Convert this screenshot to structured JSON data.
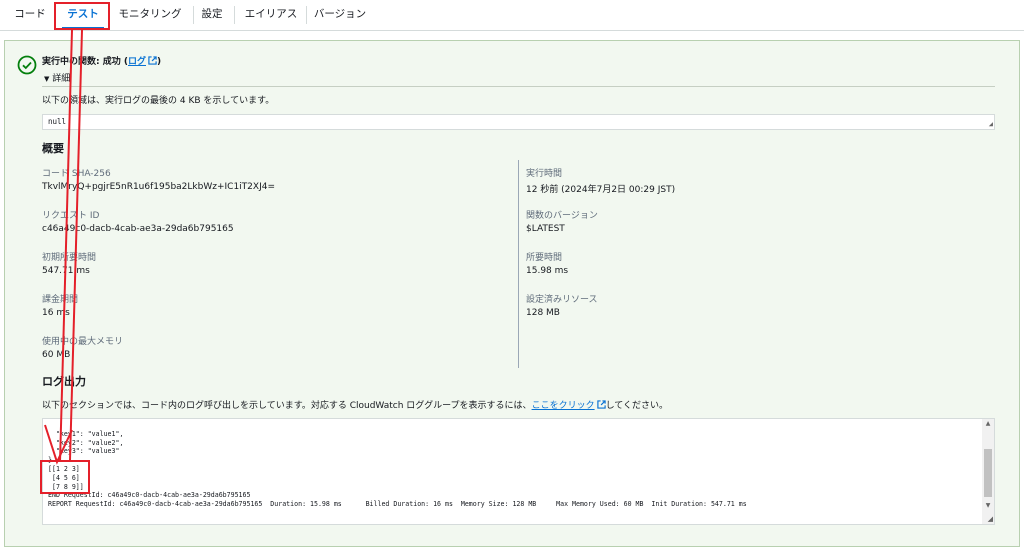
{
  "tabs": [
    {
      "label": "コード"
    },
    {
      "label": "テスト",
      "active": true
    },
    {
      "label": "モニタリング"
    },
    {
      "label": "設定"
    },
    {
      "label": "エイリアス"
    },
    {
      "label": "バージョン"
    }
  ],
  "result": {
    "status_prefix": "実行中の関数: 成功 (",
    "log_link": "ログ",
    "status_suffix": ")",
    "detail_label": "詳細",
    "description": "以下の領域は、実行ログの最後の 4 KB を示しています。",
    "output_value": "null"
  },
  "summary": {
    "title": "概要",
    "left": [
      {
        "label": "コード SHA-256",
        "value": "TkvlMryQ+pgjrE5nR1u6f195ba2LkbWz+IC1iT2XJ4="
      },
      {
        "label": "リクエスト ID",
        "value": "c46a49c0-dacb-4cab-ae3a-29da6b795165"
      },
      {
        "label": "初期所要時間",
        "value": "547.71 ms"
      },
      {
        "label": "課金期間",
        "value": "16 ms"
      },
      {
        "label": "使用中の最大メモリ",
        "value": "60 MB"
      }
    ],
    "right": [
      {
        "label": "実行時間",
        "value": "12 秒前 (2024年7月2日 00:29 JST)"
      },
      {
        "label": "関数のバージョン",
        "value": "$LATEST"
      },
      {
        "label": "所要時間",
        "value": "15.98 ms"
      },
      {
        "label": "設定済みリソース",
        "value": "128 MB"
      }
    ]
  },
  "log": {
    "title": "ログ出力",
    "description_prefix": "以下のセクションでは、コード内のログ呼び出しを示しています。対応する CloudWatch ロググループを表示するには、",
    "link": "ここをクリック",
    "description_suffix": "してください。",
    "lines": [
      "  \"key1\": \"value1\",",
      "  \"key2\": \"value2\",",
      "  \"key3\": \"value3\"",
      "}",
      "[[1 2 3]",
      " [4 5 6]",
      " [7 8 9]]",
      "END RequestId: c46a49c0-dacb-4cab-ae3a-29da6b795165",
      "REPORT RequestId: c46a49c0-dacb-4cab-ae3a-29da6b795165  Duration: 15.98 ms      Billed Duration: 16 ms  Memory Size: 128 MB     Max Memory Used: 60 MB  Init Duration: 547.71 ms"
    ]
  },
  "colors": {
    "accent": "#0972d3",
    "success": "#037f0c",
    "annotation": "#e4202a"
  }
}
